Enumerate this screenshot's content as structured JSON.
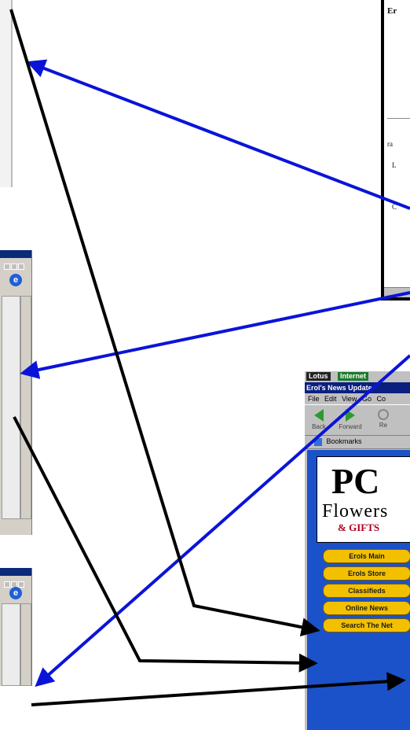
{
  "doc_window": {
    "lines": [
      "Er",
      "ra",
      "L",
      "C"
    ]
  },
  "browser": {
    "taskbar": [
      "Lotus",
      "Internet"
    ],
    "title": "Erol's News Update",
    "menu": [
      "File",
      "Edit",
      "View",
      "Go",
      "Co"
    ],
    "toolbar": [
      "Back",
      "Forward",
      "Re"
    ],
    "bookmarks_label": "Bookmarks",
    "logo": {
      "line1": "PC",
      "line2": "Flowers",
      "line3": "& GIFTS"
    },
    "nav": [
      "Erols Main",
      "Erols Store",
      "Classifieds",
      "Online News",
      "Search The Net"
    ]
  },
  "annotation_colors": {
    "blue": "#0a14d8",
    "black": "#000000"
  }
}
